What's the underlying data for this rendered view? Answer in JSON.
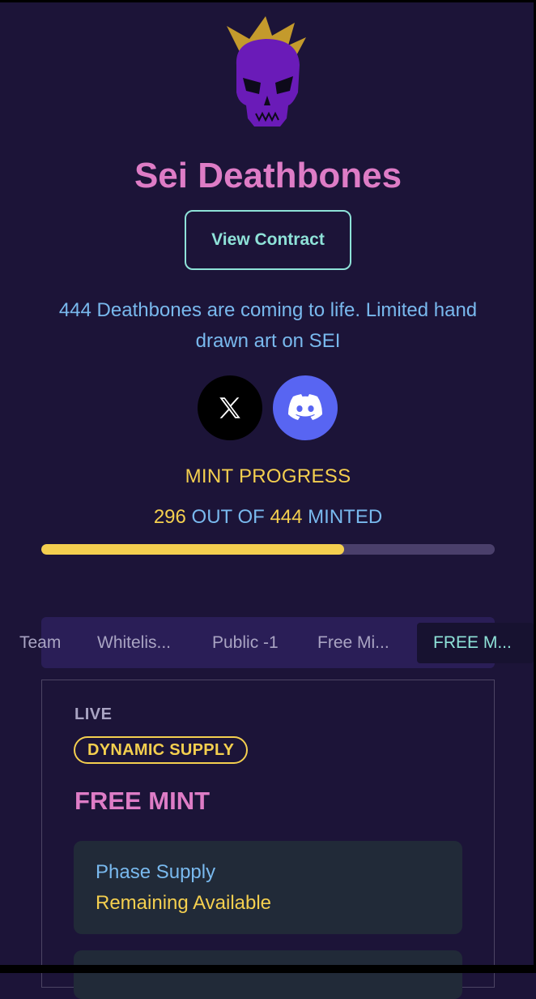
{
  "header": {
    "title": "Sei Deathbones",
    "view_contract_label": "View Contract",
    "description": "444 Deathbones are coming to life. Limited hand drawn art on SEI"
  },
  "social": [
    {
      "name": "x",
      "icon": "x-logo-icon"
    },
    {
      "name": "discord",
      "icon": "discord-logo-icon"
    }
  ],
  "progress": {
    "label": "MINT PROGRESS",
    "minted": "296",
    "out_of_text": "OUT OF",
    "total": "444",
    "minted_text": "MINTED",
    "fraction": 0.667
  },
  "tabs": [
    {
      "label": "Team",
      "active": false
    },
    {
      "label": "Whitelis...",
      "active": false
    },
    {
      "label": "Public -1",
      "active": false
    },
    {
      "label": "Free Mi...",
      "active": false
    },
    {
      "label": "FREE M...",
      "active": true
    }
  ],
  "phase": {
    "status": "LIVE",
    "badge": "DYNAMIC SUPPLY",
    "name": "FREE MINT",
    "supply_label": "Phase Supply",
    "remaining_label": "Remaining Available"
  },
  "colors": {
    "background": "#1c1438",
    "title_pink": "#de7cc6",
    "accent_teal": "#8ee2d8",
    "text_blue": "#79b9ee",
    "accent_yellow": "#f4cf4f",
    "discord_blue": "#5865f2"
  }
}
